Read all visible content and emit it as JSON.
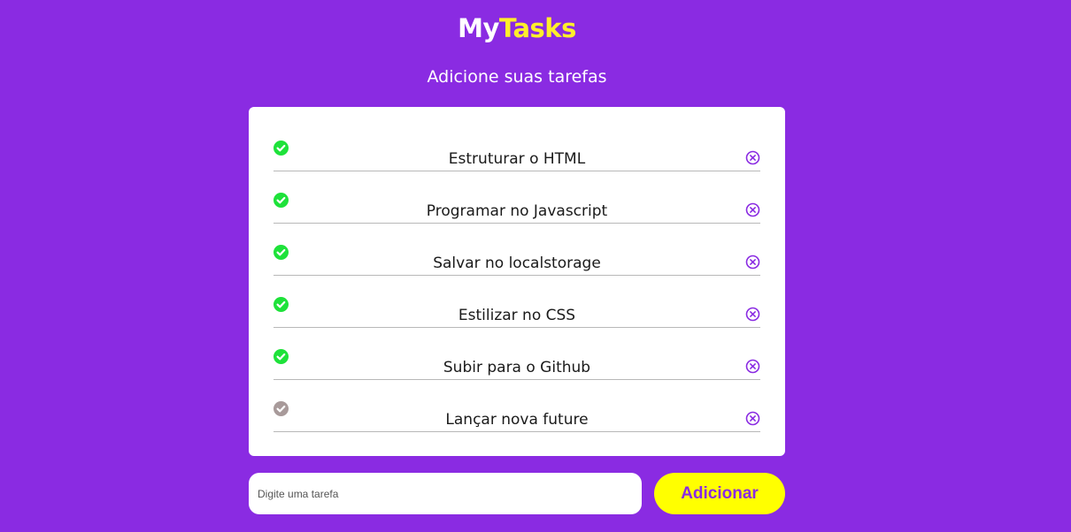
{
  "header": {
    "title_part1": "My",
    "title_part2": "Tasks",
    "subtitle": "Adicione suas tarefas"
  },
  "tasks": [
    {
      "text": "Estruturar o HTML",
      "done": true,
      "check_icon": "check-circle-icon",
      "remove_icon": "close-circle-icon"
    },
    {
      "text": "Programar no Javascript",
      "done": true,
      "check_icon": "check-circle-icon",
      "remove_icon": "close-circle-icon"
    },
    {
      "text": "Salvar no localstorage",
      "done": true,
      "check_icon": "check-circle-icon",
      "remove_icon": "close-circle-icon"
    },
    {
      "text": "Estilizar no CSS",
      "done": true,
      "check_icon": "check-circle-icon",
      "remove_icon": "close-circle-icon"
    },
    {
      "text": "Subir para o Github",
      "done": true,
      "check_icon": "check-circle-icon",
      "remove_icon": "close-circle-icon"
    },
    {
      "text": "Lançar nova future",
      "done": false,
      "check_icon": "check-circle-icon",
      "remove_icon": "close-circle-icon"
    }
  ],
  "form": {
    "input_value": "",
    "input_placeholder": "Digite uma tarefa",
    "add_label": "Adicionar"
  },
  "colors": {
    "background": "#8a2be2",
    "title_accent": "#ffee2b",
    "done_check": "#1ee23a",
    "pending_check": "#a89a9a",
    "remove_icon": "#8a2be2",
    "button_bg": "#ffff00"
  }
}
